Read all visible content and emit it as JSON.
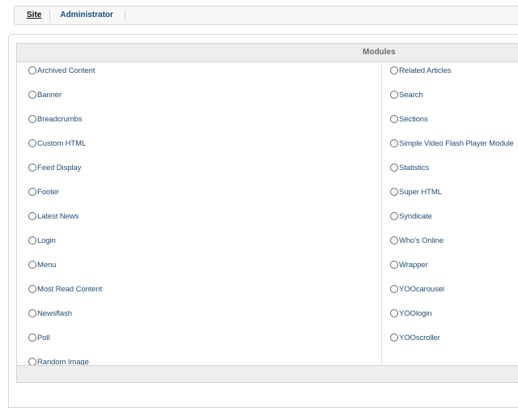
{
  "tabs": {
    "site": "Site",
    "administrator": "Administrator"
  },
  "modules": {
    "header": "Modules",
    "left": [
      "Archived Content",
      "Banner",
      "Breadcrumbs",
      "Custom HTML",
      "Feed Display",
      "Footer",
      "Latest News",
      "Login",
      "Menu",
      "Most Read Content",
      "Newsflash",
      "Poll",
      "Random Image"
    ],
    "right": [
      "Related Articles",
      "Search",
      "Sections",
      "Simple Video Flash Player Module",
      "Statistics",
      "Super HTML",
      "Syndicate",
      "Who's Online",
      "Wrapper",
      "YOOcarousel",
      "YOOlogin",
      "YOOscroller"
    ]
  }
}
